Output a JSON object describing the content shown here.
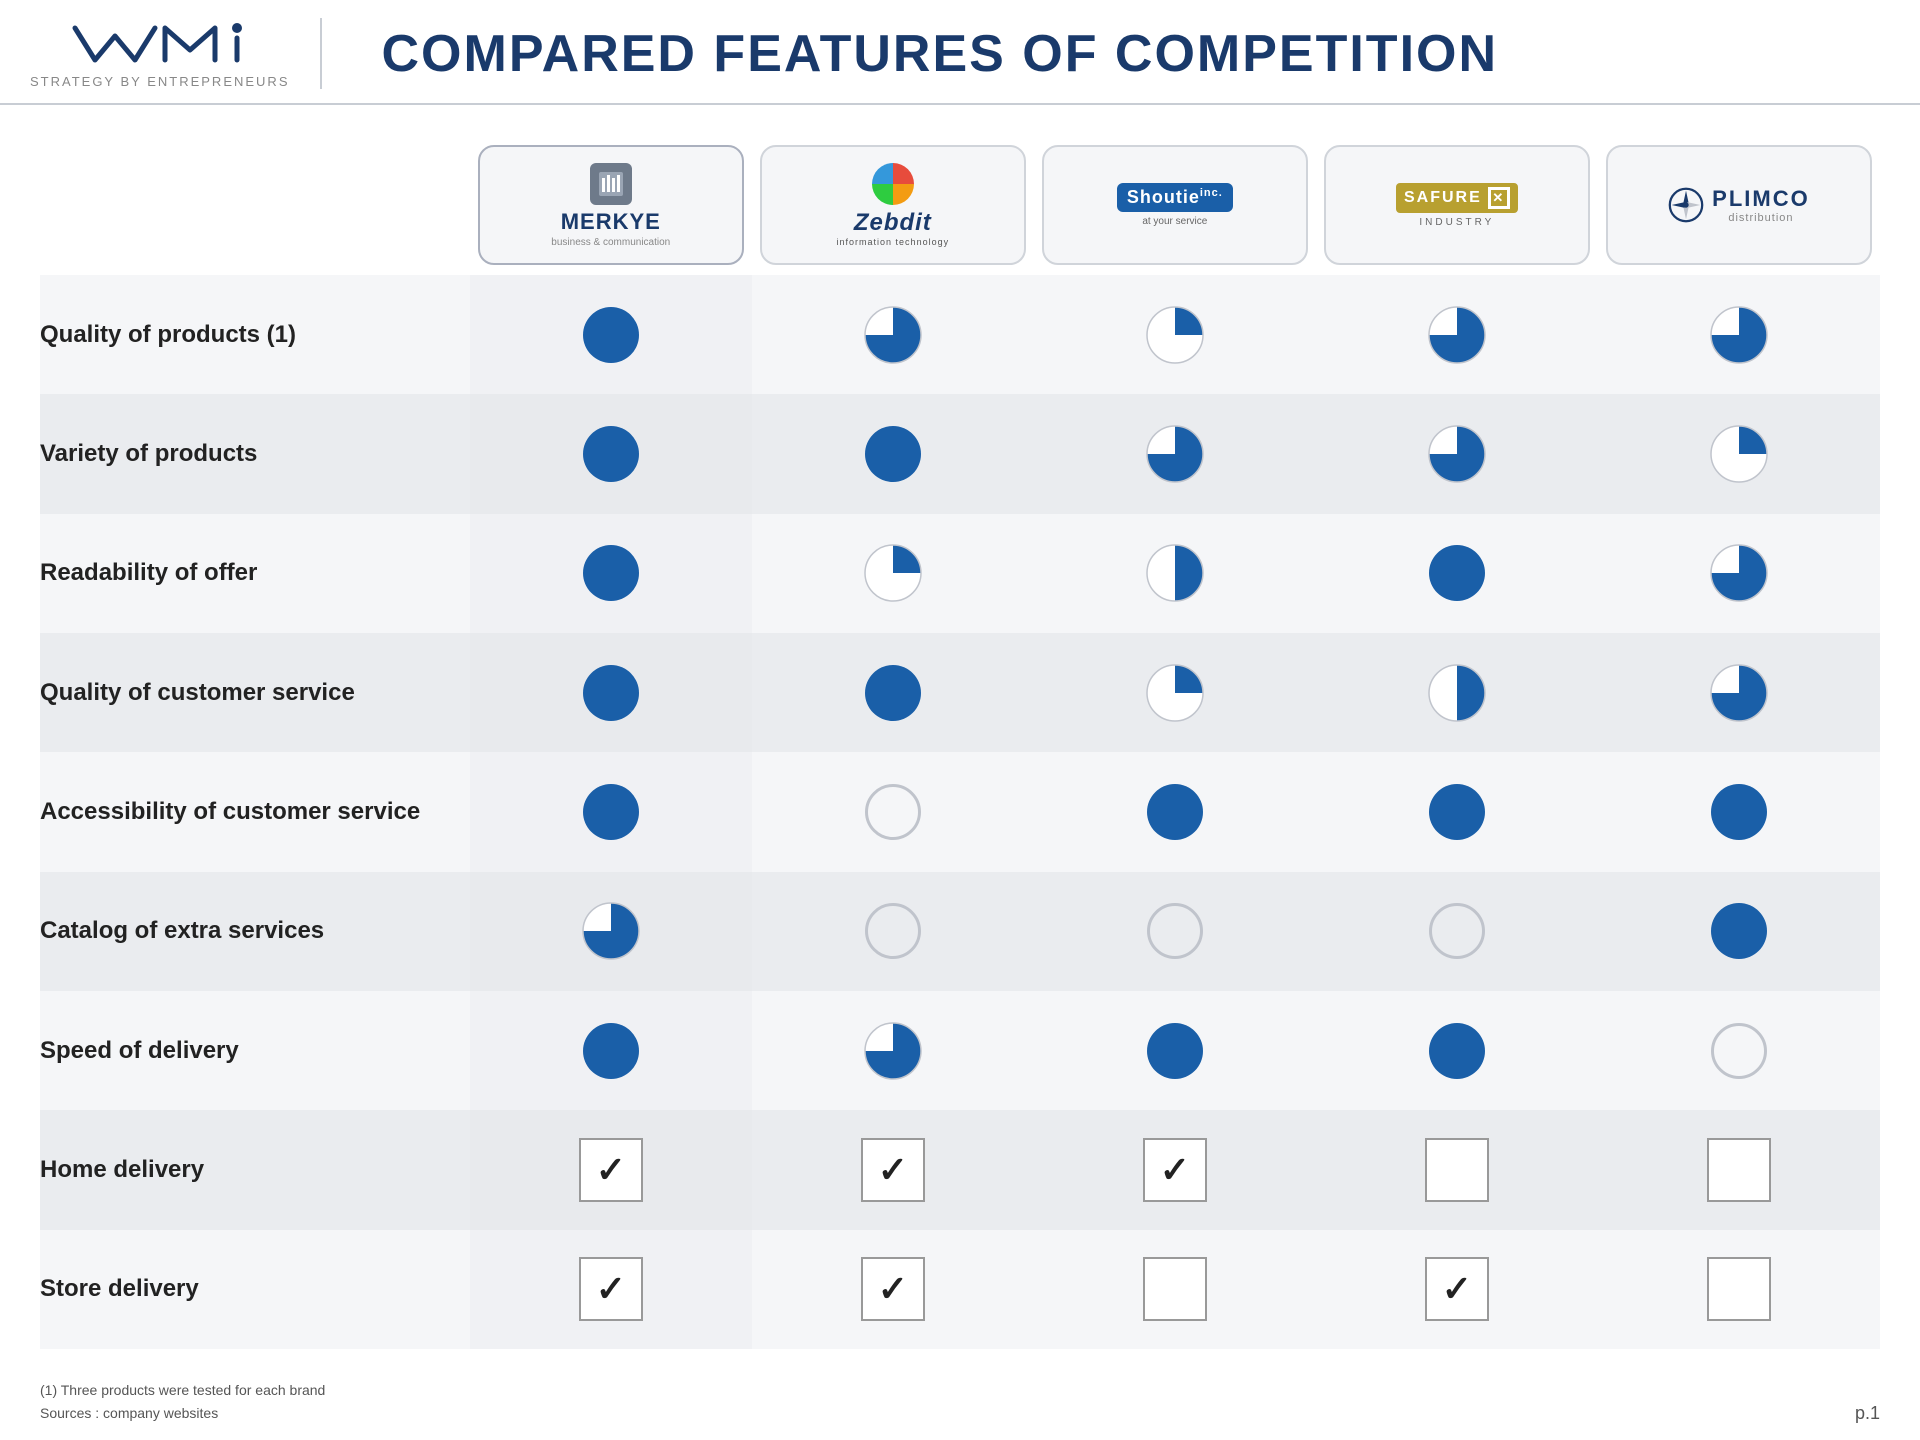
{
  "header": {
    "logo_subtitle": "STRATEGY BY ENTREPRENEURS",
    "title": "COMPARED FEATURES OF COMPETITION"
  },
  "companies": [
    {
      "id": "merkye",
      "name": "MERKYE",
      "sub": "business & communication",
      "highlighted": true
    },
    {
      "id": "zebdit",
      "name": "Zebdit",
      "sub": "information technology",
      "highlighted": false
    },
    {
      "id": "shoutie",
      "name": "Shoutie inc.",
      "sub": "at your service",
      "highlighted": false
    },
    {
      "id": "safure",
      "name": "SAFURE",
      "sub": "INDUSTRY",
      "highlighted": false
    },
    {
      "id": "plimco",
      "name": "PLIMCO",
      "sub": "distribution",
      "highlighted": false
    }
  ],
  "features": [
    {
      "label": "Quality of products (1)",
      "values": [
        "full",
        "three-quarter",
        "quarter",
        "three-quarter",
        "three-quarter"
      ]
    },
    {
      "label": "Variety of products",
      "values": [
        "full",
        "full",
        "three-quarter",
        "three-quarter",
        "quarter"
      ]
    },
    {
      "label": "Readability of offer",
      "values": [
        "full",
        "quarter",
        "half",
        "full",
        "three-quarter"
      ]
    },
    {
      "label": "Quality of customer service",
      "values": [
        "full",
        "full",
        "quarter",
        "half",
        "three-quarter"
      ]
    },
    {
      "label": "Accessibility of customer service",
      "values": [
        "full",
        "empty",
        "full",
        "full",
        "full"
      ]
    },
    {
      "label": "Catalog of extra services",
      "values": [
        "three-quarter",
        "empty",
        "empty",
        "empty",
        "full"
      ]
    },
    {
      "label": "Speed of delivery",
      "values": [
        "full",
        "three-quarter",
        "full",
        "full",
        "empty"
      ]
    },
    {
      "label": "Home delivery",
      "values": [
        "check",
        "check",
        "check",
        "empty-box",
        "empty-box"
      ]
    },
    {
      "label": "Store delivery",
      "values": [
        "check",
        "check",
        "empty-box",
        "check",
        "empty-box"
      ]
    }
  ],
  "footer": {
    "note_line1": "(1) Three products were tested for each brand",
    "note_line2": "Sources : company websites",
    "page": "p.1"
  }
}
